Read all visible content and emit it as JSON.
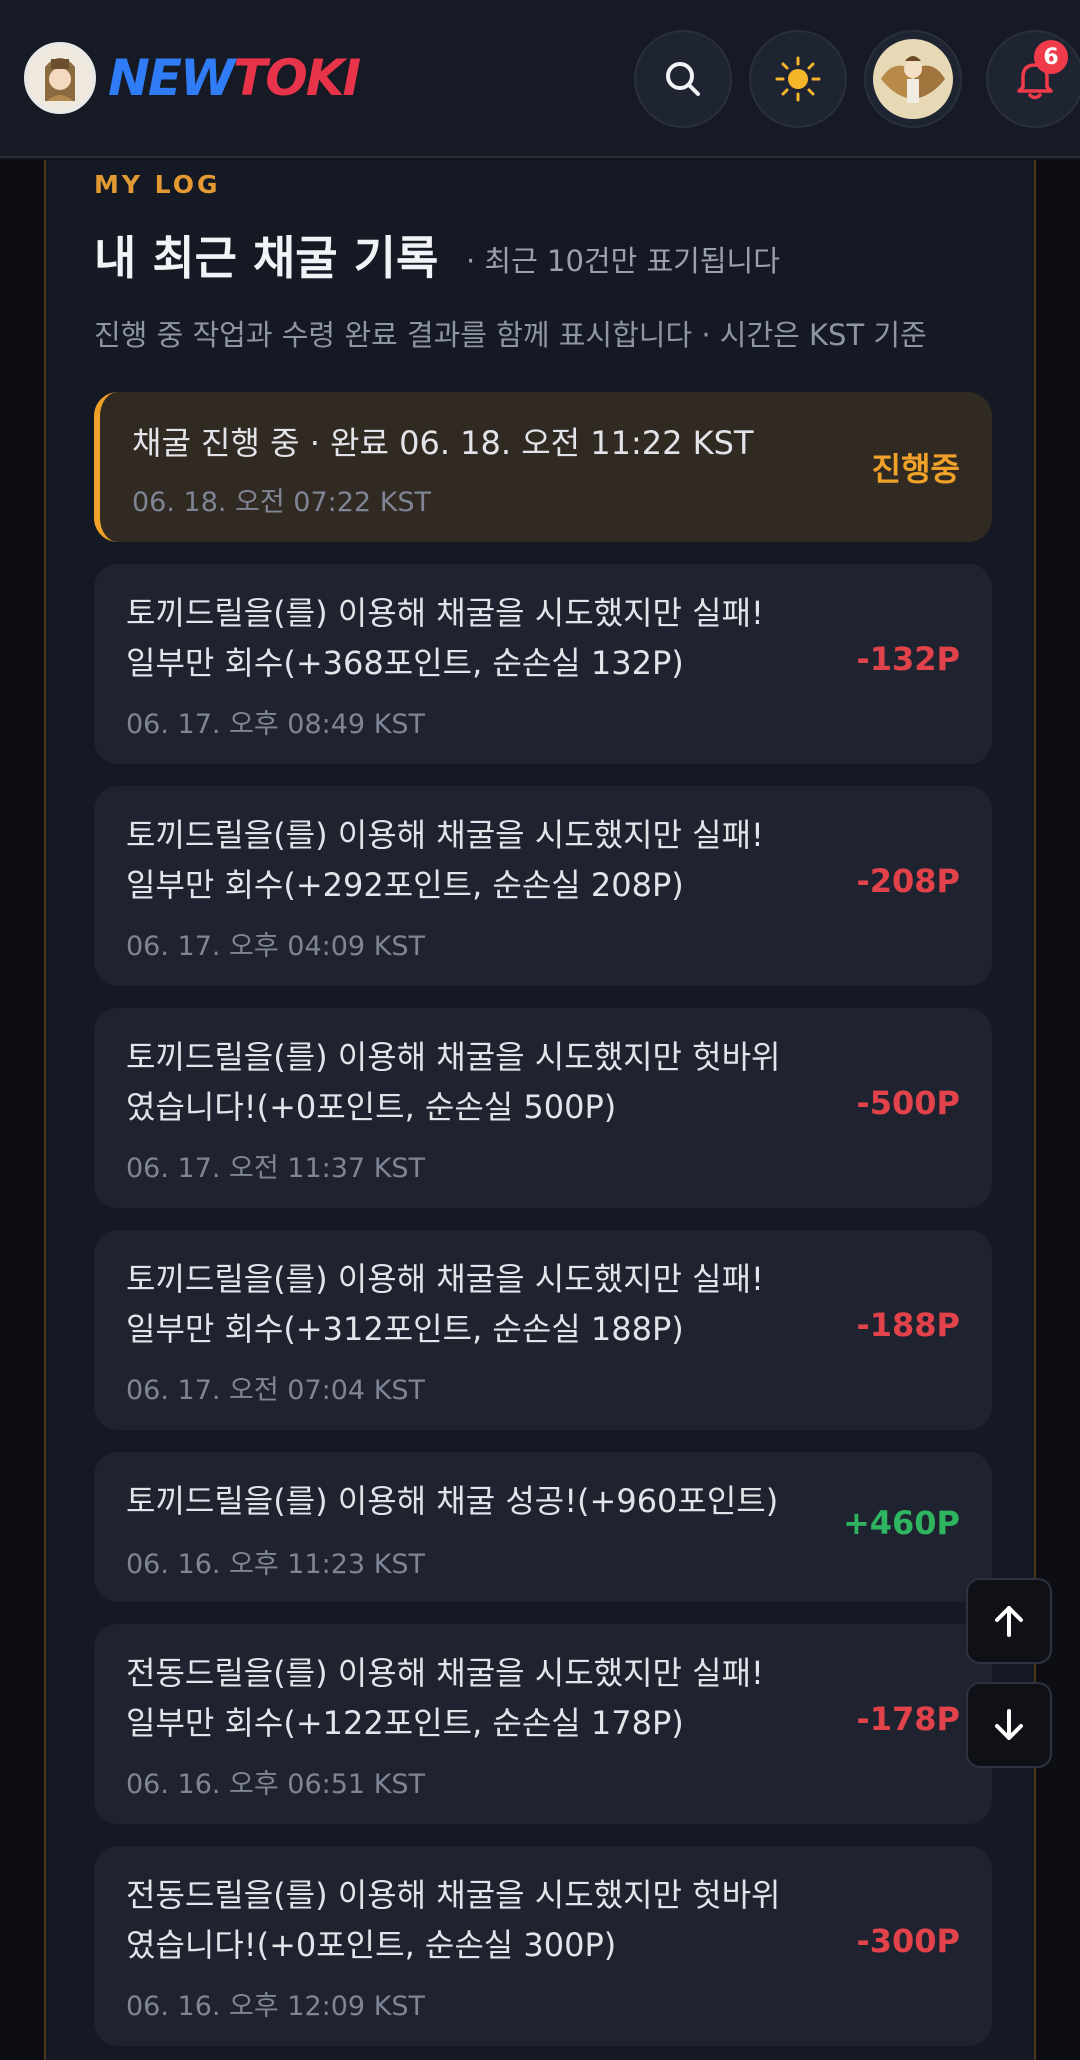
{
  "header": {
    "logo_new": "NEW",
    "logo_toki": "TOKI",
    "notification_count": "6",
    "icons": [
      "search-icon",
      "sun-icon",
      "user-avatar",
      "bell-icon"
    ]
  },
  "section": {
    "eyebrow": "MY LOG",
    "title": "내 최근 채굴 기록",
    "subtitle": "· 최근 10건만 표기됩니다",
    "description": "진행 중 작업과 수령 완료 결과를 함께 표시합니다 · 시간은 KST 기준"
  },
  "logs": [
    {
      "line1": "채굴 진행 중 · 완료 06. 18. 오전 11:22 KST",
      "line2": "",
      "time": "06. 18. 오전 07:22 KST",
      "amount": "진행중",
      "status": "progress"
    },
    {
      "line1": "토끼드릴을(를) 이용해 채굴을 시도했지만 실패!",
      "line2": "일부만 회수(+368포인트, 순손실 132P)",
      "time": "06. 17. 오후 08:49 KST",
      "amount": "-132P",
      "status": "negative"
    },
    {
      "line1": "토끼드릴을(를) 이용해 채굴을 시도했지만 실패!",
      "line2": "일부만 회수(+292포인트, 순손실 208P)",
      "time": "06. 17. 오후 04:09 KST",
      "amount": "-208P",
      "status": "negative"
    },
    {
      "line1": "토끼드릴을(를) 이용해 채굴을 시도했지만 헛바위",
      "line2": "였습니다!(+0포인트, 순손실 500P)",
      "time": "06. 17. 오전 11:37 KST",
      "amount": "-500P",
      "status": "negative"
    },
    {
      "line1": "토끼드릴을(를) 이용해 채굴을 시도했지만 실패!",
      "line2": "일부만 회수(+312포인트, 순손실 188P)",
      "time": "06. 17. 오전 07:04 KST",
      "amount": "-188P",
      "status": "negative"
    },
    {
      "line1": "토끼드릴을(를) 이용해 채굴 성공!(+960포인트)",
      "line2": "",
      "time": "06. 16. 오후 11:23 KST",
      "amount": "+460P",
      "status": "positive"
    },
    {
      "line1": "전동드릴을(를) 이용해 채굴을 시도했지만 실패!",
      "line2": "일부만 회수(+122포인트, 순손실 178P)",
      "time": "06. 16. 오후 06:51 KST",
      "amount": "-178P",
      "status": "negative"
    },
    {
      "line1": "전동드릴을(를) 이용해 채굴을 시도했지만 헛바위",
      "line2": "였습니다!(+0포인트, 순손실 300P)",
      "time": "06. 16. 오후 12:09 KST",
      "amount": "-300P",
      "status": "negative"
    }
  ],
  "colors": {
    "accent": "#f0a12a",
    "negative": "#e2424a",
    "positive": "#2fb560",
    "brand_blue": "#2f7cf6",
    "brand_red": "#e8344a"
  }
}
